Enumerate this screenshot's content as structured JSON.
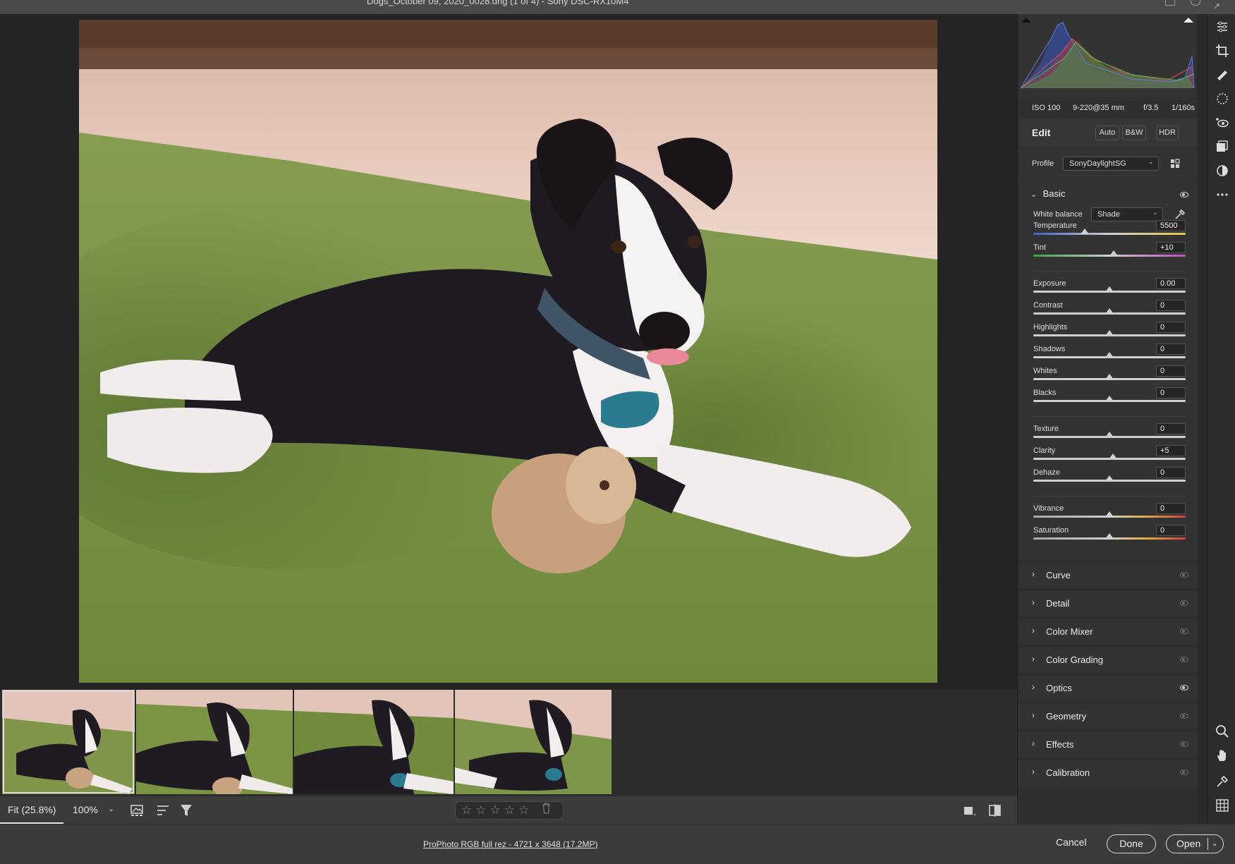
{
  "window": {
    "title": "Dogs_October 09, 2020_0028.dng (1 of 4)  -  Sony DSC-RX10M4"
  },
  "exif": {
    "iso": "ISO 100",
    "focal": "9-220@35 mm",
    "aperture": "f/3.5",
    "shutter": "1/160s"
  },
  "edit": {
    "title": "Edit",
    "auto": "Auto",
    "bw": "B&W",
    "hdr": "HDR"
  },
  "profile": {
    "label": "Profile",
    "value": "SonyDaylightSG"
  },
  "basic": {
    "title": "Basic",
    "white_balance_label": "White balance",
    "white_balance_value": "Shade",
    "sliders": [
      {
        "label": "Temperature",
        "value": "5500",
        "pos": 0.34
      },
      {
        "label": "Tint",
        "value": "+10",
        "pos": 0.53
      },
      {
        "label": "Exposure",
        "value": "0.00",
        "pos": 0.5
      },
      {
        "label": "Contrast",
        "value": "0",
        "pos": 0.5
      },
      {
        "label": "Highlights",
        "value": "0",
        "pos": 0.5
      },
      {
        "label": "Shadows",
        "value": "0",
        "pos": 0.5
      },
      {
        "label": "Whites",
        "value": "0",
        "pos": 0.5
      },
      {
        "label": "Blacks",
        "value": "0",
        "pos": 0.5
      },
      {
        "label": "Texture",
        "value": "0",
        "pos": 0.5
      },
      {
        "label": "Clarity",
        "value": "+5",
        "pos": 0.525
      },
      {
        "label": "Dehaze",
        "value": "0",
        "pos": 0.5
      },
      {
        "label": "Vibrance",
        "value": "0",
        "pos": 0.5
      },
      {
        "label": "Saturation",
        "value": "0",
        "pos": 0.5
      }
    ]
  },
  "sections": [
    {
      "label": "Curve",
      "eye_on": false
    },
    {
      "label": "Detail",
      "eye_on": false
    },
    {
      "label": "Color Mixer",
      "eye_on": false
    },
    {
      "label": "Color Grading",
      "eye_on": false
    },
    {
      "label": "Optics",
      "eye_on": true
    },
    {
      "label": "Geometry",
      "eye_on": false
    },
    {
      "label": "Effects",
      "eye_on": false
    },
    {
      "label": "Calibration",
      "eye_on": false
    }
  ],
  "bottombar": {
    "zoom_fit": "Fit (25.8%)",
    "zoom_100": "100%",
    "stars": "☆☆☆☆☆"
  },
  "footer": {
    "workflow": "ProPhoto RGB full rez - 4721 x 3648 (17.2MP)",
    "cancel": "Cancel",
    "done": "Done",
    "open": "Open"
  },
  "colors": {
    "accent": "#e0e0e0",
    "panel_bg": "#333333",
    "canvas_bg": "#242424"
  }
}
